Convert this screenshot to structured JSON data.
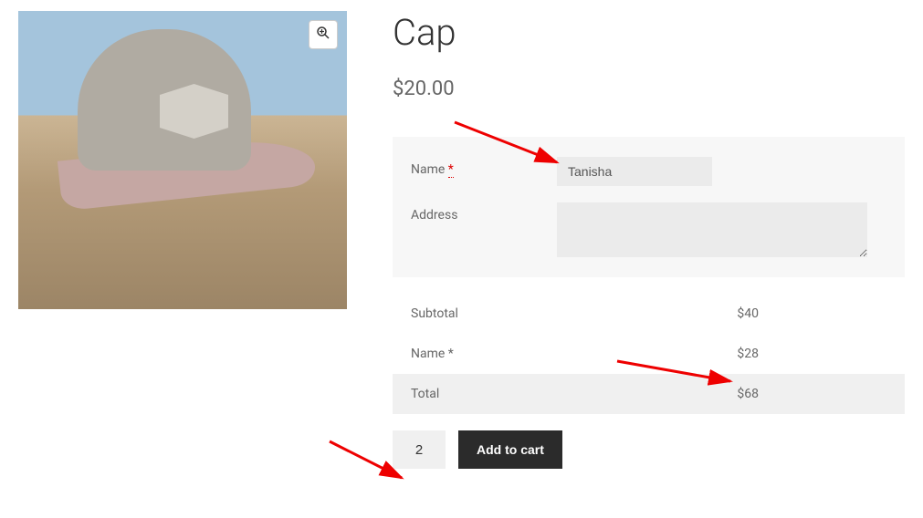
{
  "product": {
    "title": "Cap",
    "price": "$20.00"
  },
  "form": {
    "name_label": "Name",
    "name_value": "Tanisha",
    "address_label": "Address",
    "address_value": ""
  },
  "pricing": {
    "subtotal_label": "Subtotal",
    "subtotal_value": "$40",
    "name_label": "Name *",
    "name_value": "$28",
    "total_label": "Total",
    "total_value": "$68"
  },
  "cart": {
    "quantity": "2",
    "button_label": "Add to cart"
  },
  "icons": {
    "zoom": "search-plus-icon"
  }
}
